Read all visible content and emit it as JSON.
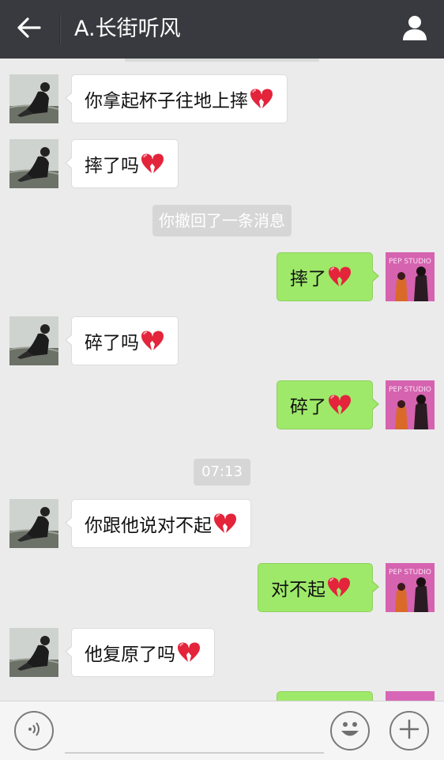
{
  "header": {
    "title": "A.长街听风",
    "back_icon": "arrow-left-icon",
    "profile_icon": "person-icon"
  },
  "colors": {
    "topbar": "#393a3f",
    "background": "#ebebeb",
    "outgoing_bubble": "#9ee96a",
    "incoming_bubble": "#ffffff",
    "system_pill": "#d6d6d6"
  },
  "messages": [
    {
      "side": "in",
      "text": "你拿起杯子往地上摔",
      "emoji": "broken-heart"
    },
    {
      "side": "in",
      "text": "摔了吗",
      "emoji": "broken-heart"
    },
    {
      "side": "system",
      "text": "你撤回了一条消息"
    },
    {
      "side": "out",
      "text": "摔了",
      "emoji": "broken-heart"
    },
    {
      "side": "in",
      "text": "碎了吗",
      "emoji": "broken-heart"
    },
    {
      "side": "out",
      "text": "碎了",
      "emoji": "broken-heart"
    },
    {
      "side": "time",
      "text": "07:13"
    },
    {
      "side": "in",
      "text": "你跟他说对不起",
      "emoji": "broken-heart"
    },
    {
      "side": "out",
      "text": "对不起",
      "emoji": "broken-heart"
    },
    {
      "side": "in",
      "text": "他复原了吗",
      "emoji": "broken-heart"
    }
  ],
  "avatars": {
    "contact": "contact-avatar-sitting-figure",
    "self_text": "PEP STUDIO"
  },
  "input": {
    "voice_icon": "voice-icon",
    "emoji_icon": "smiley-icon",
    "plus_icon": "plus-icon",
    "value": ""
  }
}
